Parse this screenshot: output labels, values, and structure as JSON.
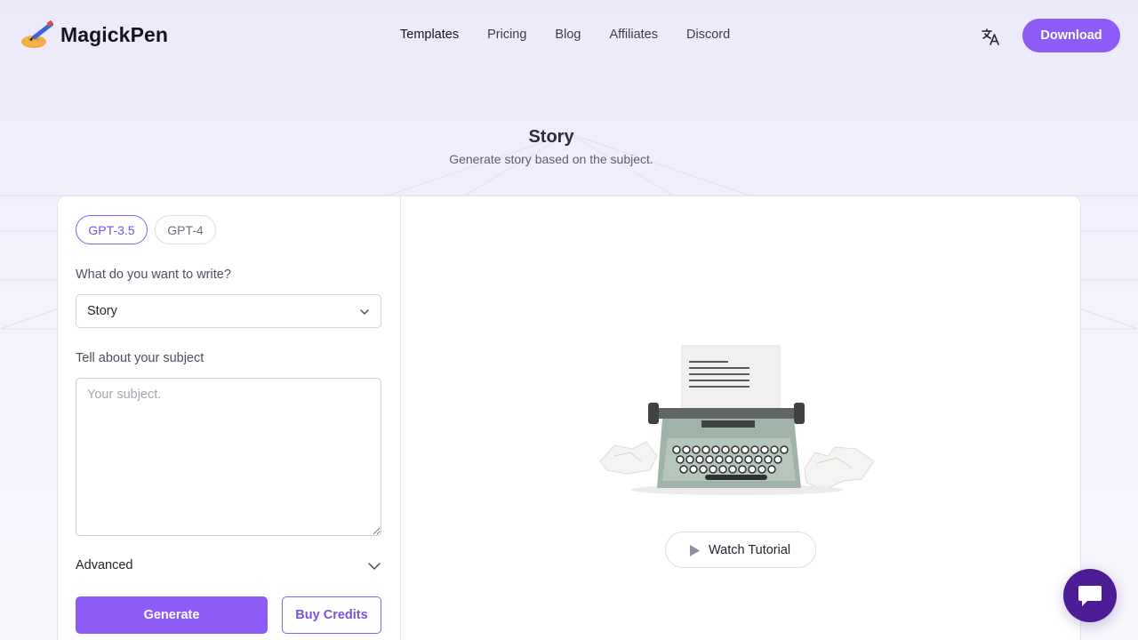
{
  "header": {
    "brand": "MagickPen",
    "nav": [
      "Templates",
      "Pricing",
      "Blog",
      "Affiliates",
      "Discord"
    ],
    "active_nav": "Templates",
    "language_icon": "translate-icon",
    "download_label": "Download"
  },
  "page": {
    "title": "Story",
    "subtitle": "Generate story based on the subject."
  },
  "form": {
    "models": [
      "GPT-3.5",
      "GPT-4"
    ],
    "selected_model": "GPT-3.5",
    "write_label": "What do you want to write?",
    "write_value": "Story",
    "subject_label": "Tell about your subject",
    "subject_placeholder": "Your subject.",
    "subject_value": "",
    "advanced_label": "Advanced",
    "generate_label": "Generate",
    "buy_credits_label": "Buy Credits"
  },
  "preview": {
    "tutorial_label": "Watch Tutorial"
  },
  "colors": {
    "accent": "#8b5cf6",
    "chat_bubble": "#4c1d95",
    "background": "#ece9fb"
  }
}
